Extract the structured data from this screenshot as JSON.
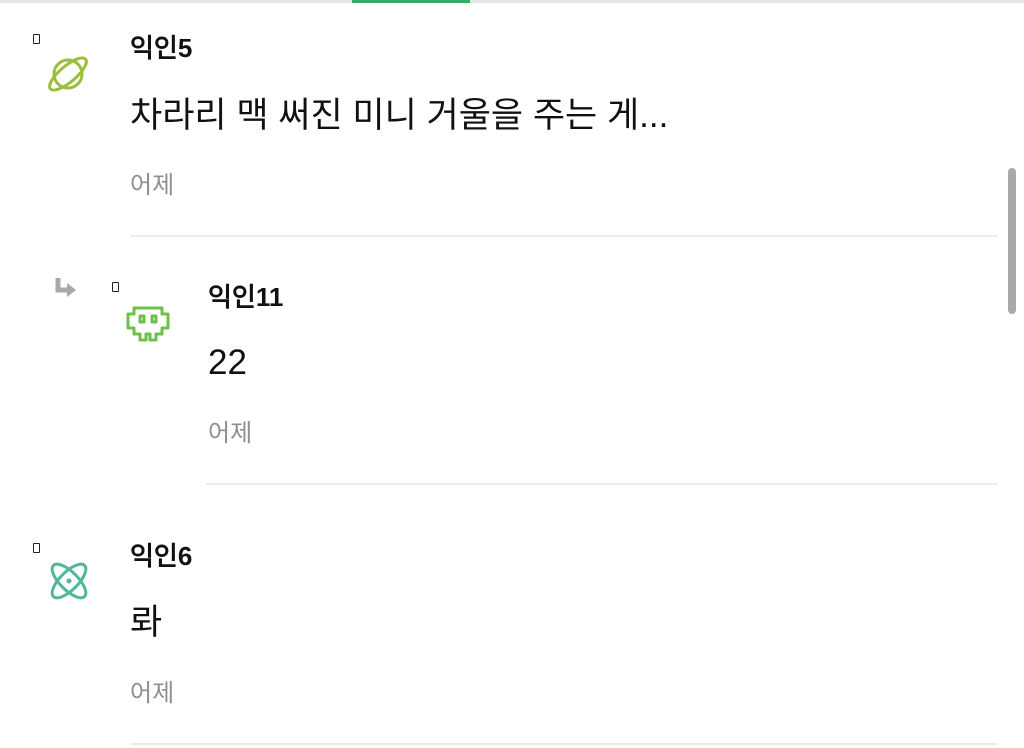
{
  "comments": [
    {
      "author": "익인5",
      "text": "차라리 맥 써진 미니 거울을 주는 게...",
      "time": "어제",
      "avatar_icon": "planet-icon",
      "avatar_color": "#9cbf3a",
      "is_reply": false
    },
    {
      "author": "익인11",
      "text": "22",
      "time": "어제",
      "avatar_icon": "space-invader-icon",
      "avatar_color": "#6cc04a",
      "is_reply": true,
      "reply_icon": "reply-arrow-icon"
    },
    {
      "author": "익인6",
      "text": "롸",
      "time": "어제",
      "avatar_icon": "atom-icon",
      "avatar_color": "#4fb79a",
      "is_reply": false
    }
  ],
  "colors": {
    "tab_accent": "#3aa86a",
    "time_text": "#8e8e8e",
    "divider": "#ececec"
  }
}
